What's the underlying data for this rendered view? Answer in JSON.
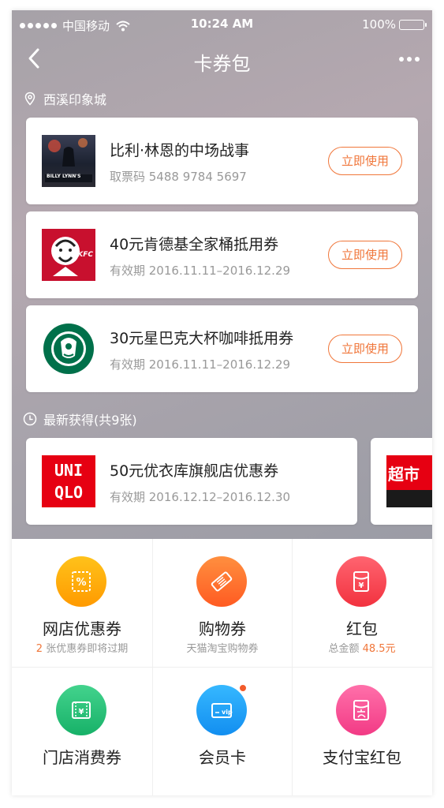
{
  "status_bar": {
    "carrier": "中国移动",
    "time": "10:24 AM",
    "battery": "100%"
  },
  "nav": {
    "title": "卡券包"
  },
  "location": {
    "label": "西溪印象城"
  },
  "coupons": [
    {
      "title": "比利·林恩的中场战事",
      "sub": "取票码 5488 9784 5697",
      "button": "立即使用",
      "poster_text": "BILLY LYNN'S"
    },
    {
      "title": "40元肯德基全家桶抵用券",
      "sub": "有效期 2016.11.11–2016.12.29",
      "button": "立即使用",
      "logo_text": "KFC"
    },
    {
      "title": "30元星巴克大杯咖啡抵用券",
      "sub": "有效期 2016.11.11–2016.12.29",
      "button": "立即使用"
    }
  ],
  "recent": {
    "label": "最新获得(共9张)",
    "items": [
      {
        "title": "50元优衣库旗舰店优惠券",
        "sub": "有效期 2016.12.12–2016.12.30",
        "logo_line1": "UNI",
        "logo_line2": "QLO"
      },
      {
        "logo_text": "超市"
      }
    ]
  },
  "grid": [
    {
      "name": "网店优惠券",
      "hint_accent": "2",
      "hint_text": " 张优惠券即将过期",
      "icon": "coupon-percent-icon",
      "color_from": "#ffb400",
      "color_to": "#ff9800"
    },
    {
      "name": "购物券",
      "hint_text": "天猫淘宝购物券",
      "icon": "ticket-icon",
      "color_from": "#ff8a3d",
      "color_to": "#ff5a1f"
    },
    {
      "name": "红包",
      "hint_text": "总金额 ",
      "hint_accent_after": "48.5元",
      "icon": "red-packet-icon",
      "color_from": "#ff5a6a",
      "color_to": "#f5323f"
    },
    {
      "name": "门店消费券",
      "icon": "store-coupon-icon",
      "color_from": "#3fd08a",
      "color_to": "#1ab46a"
    },
    {
      "name": "会员卡",
      "icon": "vip-card-icon",
      "color_from": "#2fb4ff",
      "color_to": "#118ef0",
      "badge_text": "vip"
    },
    {
      "name": "支付宝红包",
      "icon": "alipay-red-packet-icon",
      "color_from": "#ff6aa6",
      "color_to": "#f53c86"
    }
  ],
  "colors": {
    "accent": "#f0763a",
    "hero_bg": "#a9a4ac"
  }
}
